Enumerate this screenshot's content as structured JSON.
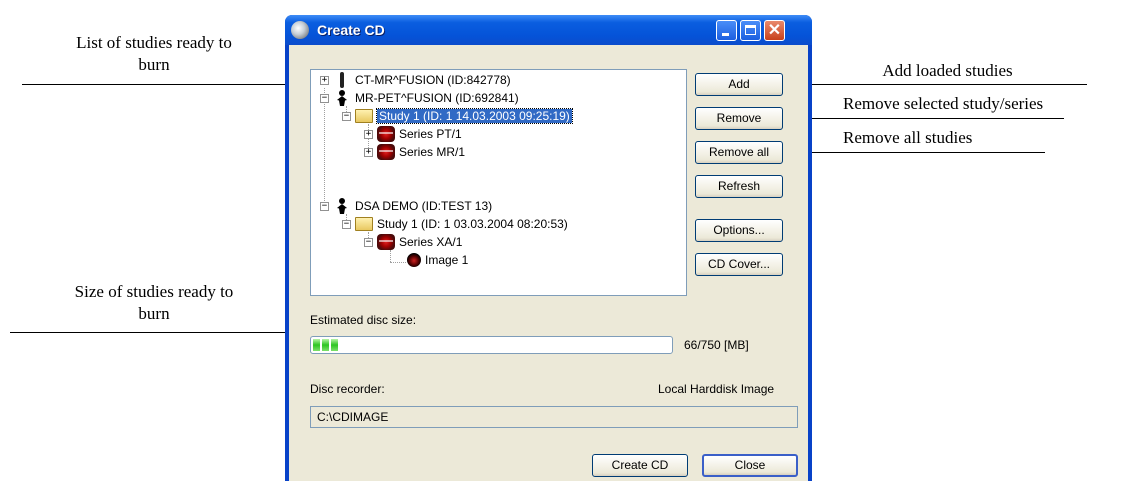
{
  "annotations": {
    "list_studies_line1": "List of studies ready to",
    "list_studies_line2": "burn",
    "size_studies_line1": "Size of studies ready to",
    "size_studies_line2": "burn",
    "add_loaded": "Add loaded studies",
    "remove_selected": "Remove selected study/series",
    "remove_all": "Remove all studies"
  },
  "window": {
    "title": "Create CD",
    "close_glyph": "✕"
  },
  "tree": {
    "expand_plus": "+",
    "expand_minus": "−",
    "items": [
      {
        "label": "CT-MR^FUSION (ID:842778)"
      },
      {
        "label": "MR-PET^FUSION (ID:692841)"
      },
      {
        "label": "Study 1 (ID: 1 14.03.2003 09:25:19)"
      },
      {
        "label": "Series PT/1"
      },
      {
        "label": "Series MR/1"
      },
      {
        "label": "DSA DEMO (ID:TEST 13)"
      },
      {
        "label": "Study 1 (ID: 1 03.03.2004 08:20:53)"
      },
      {
        "label": "Series XA/1"
      },
      {
        "label": "Image 1"
      }
    ]
  },
  "buttons": {
    "add": "Add",
    "remove": "Remove",
    "remove_all": "Remove all",
    "refresh": "Refresh",
    "options": "Options...",
    "cd_cover": "CD Cover...",
    "create_cd": "Create CD",
    "close": "Close"
  },
  "disc": {
    "estimated_label": "Estimated disc size:",
    "size_text": "66/750 [MB]",
    "progress_fraction": 0.088,
    "recorder_label": "Disc recorder:",
    "recorder_value": "Local Harddisk Image",
    "path_value": "C:\\CDIMAGE"
  }
}
